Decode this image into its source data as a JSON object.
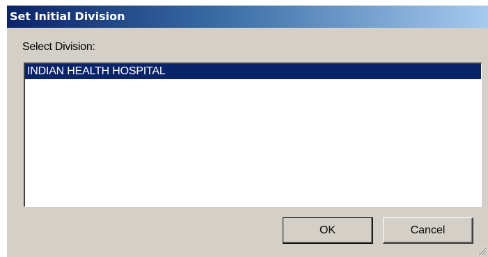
{
  "dialog": {
    "title": "Set Initial Division",
    "select_label": "Select Division:",
    "divisions": [
      {
        "label": "INDIAN HEALTH HOSPITAL",
        "selected": true
      }
    ],
    "ok_label": "OK",
    "cancel_label": "Cancel"
  },
  "colors": {
    "title_bar_start": "#0a246a",
    "title_bar_end": "#a6caf0",
    "window_face": "#d4d0c8",
    "selection": "#0a246a"
  }
}
